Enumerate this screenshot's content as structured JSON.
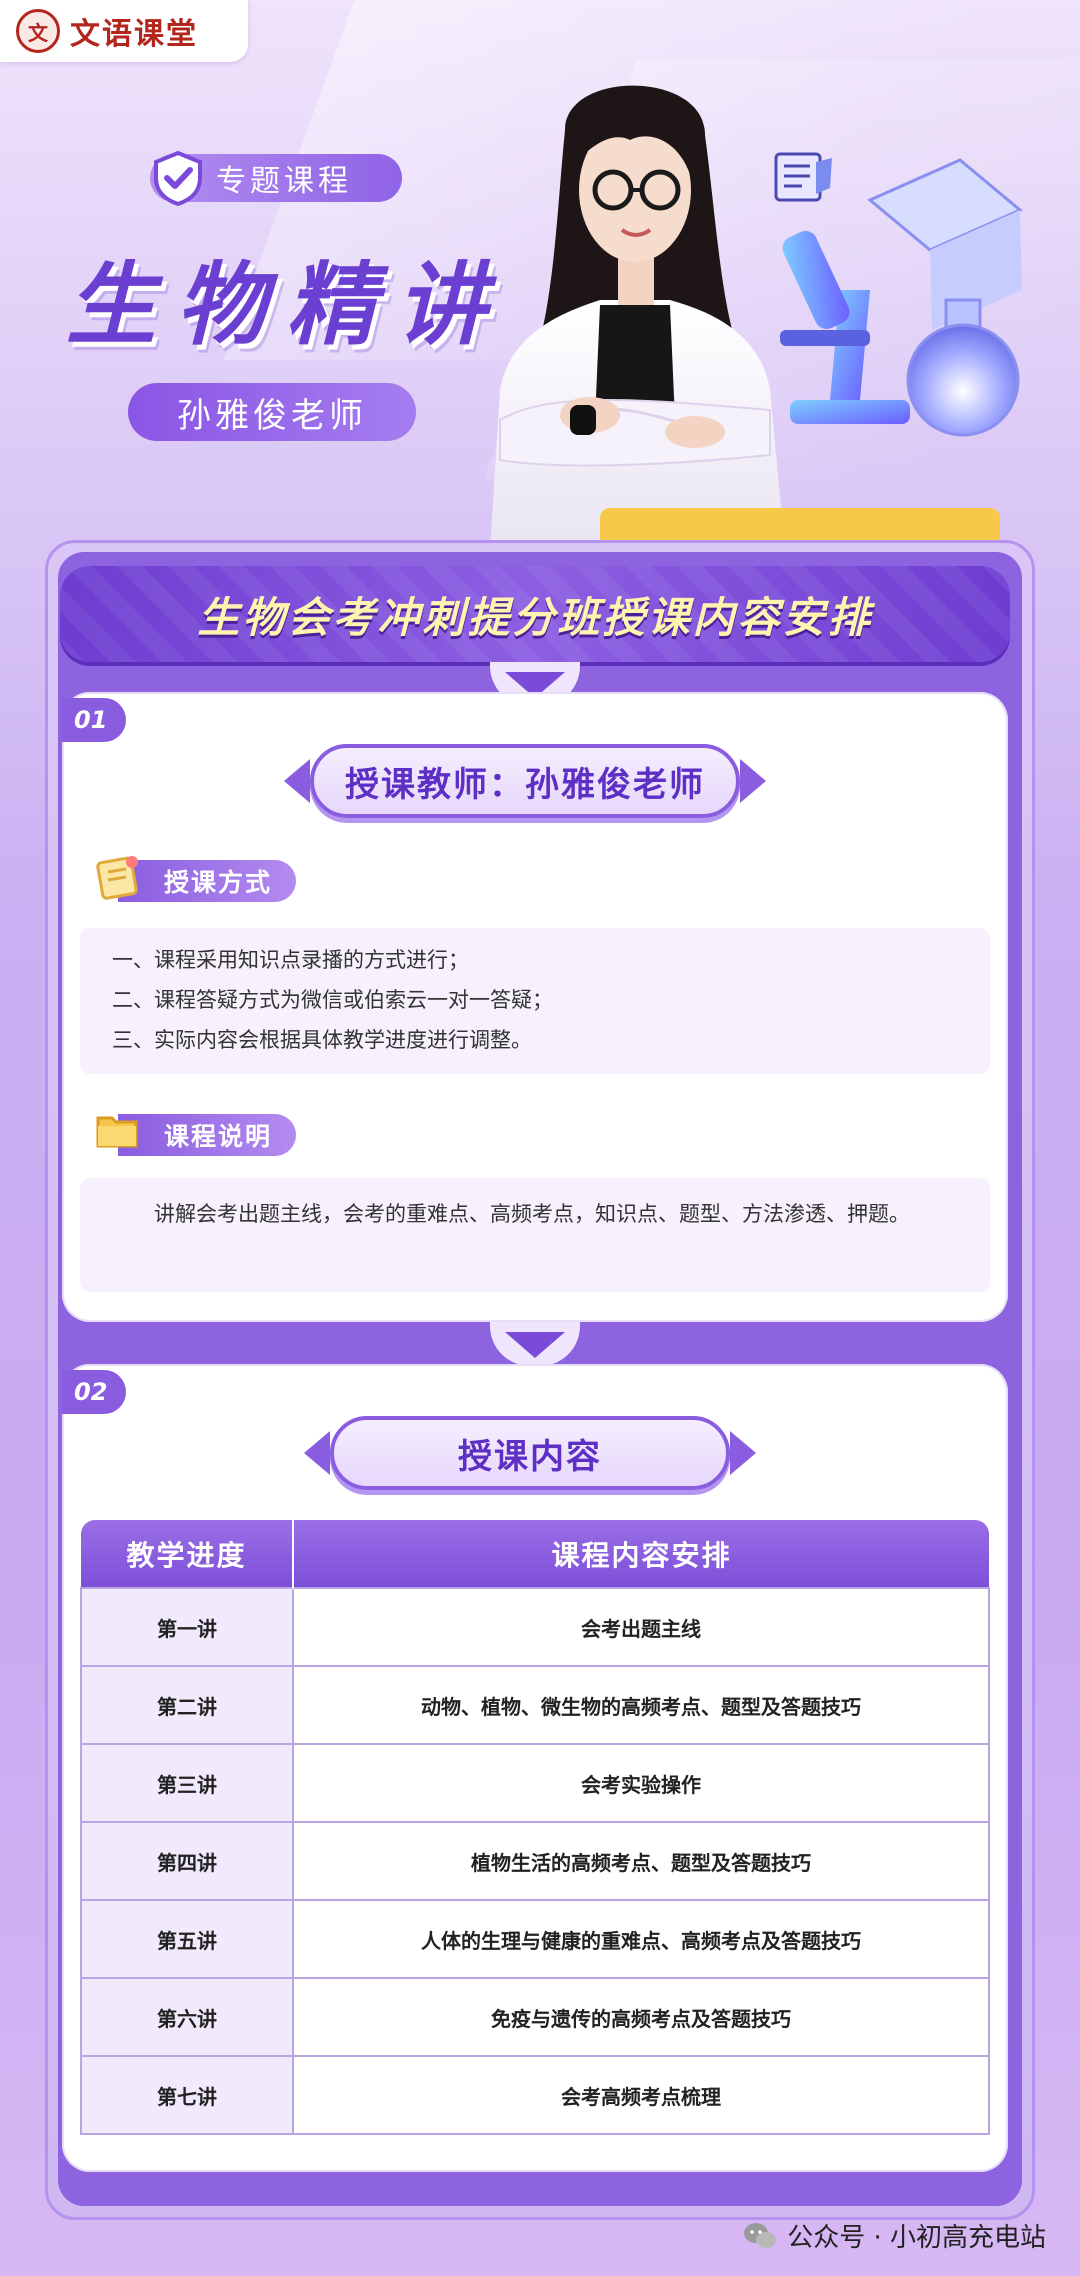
{
  "brand": {
    "logo_text": "文语课堂",
    "seal_glyph": "文"
  },
  "hero": {
    "tag": "专题课程",
    "title": "生物精讲",
    "teacher": "孙雅俊老师"
  },
  "banner": {
    "title": "生物会考冲刺提分班授课内容安排"
  },
  "section1": {
    "number": "01",
    "title": "授课教师：孙雅俊老师",
    "method": {
      "label": "授课方式",
      "items": [
        "一、课程采用知识点录播的方式进行；",
        "二、课程答疑方式为微信或伯索云一对一答疑；",
        "三、实际内容会根据具体教学进度进行调整。"
      ]
    },
    "description": {
      "label": "课程说明",
      "text": "讲解会考出题主线，会考的重难点、高频考点，知识点、题型、方法渗透、押题。"
    }
  },
  "section2": {
    "number": "02",
    "title": "授课内容",
    "table": {
      "headers": [
        "教学进度",
        "课程内容安排"
      ],
      "rows": [
        [
          "第一讲",
          "会考出题主线"
        ],
        [
          "第二讲",
          "动物、植物、微生物的高频考点、题型及答题技巧"
        ],
        [
          "第三讲",
          "会考实验操作"
        ],
        [
          "第四讲",
          "植物生活的高频考点、题型及答题技巧"
        ],
        [
          "第五讲",
          "人体的生理与健康的重难点、高频考点及答题技巧"
        ],
        [
          "第六讲",
          "免疫与遗传的高频考点及答题技巧"
        ],
        [
          "第七讲",
          "会考高频考点梳理"
        ]
      ]
    }
  },
  "footer": {
    "watermark": "公众号 · 小初高充电站"
  },
  "colors": {
    "accent": "#8a5ce0",
    "banner_text": "#fff3b0",
    "brand_red": "#b3261e",
    "highlight": "#f7c948"
  }
}
